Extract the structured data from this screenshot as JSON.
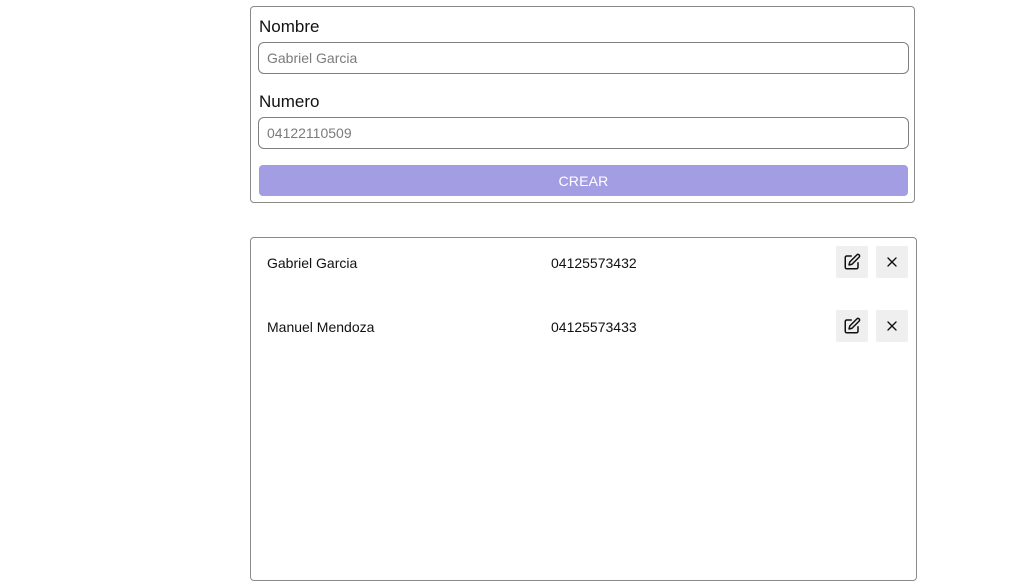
{
  "form": {
    "nombre_label": "Nombre",
    "nombre_placeholder": "Gabriel Garcia",
    "nombre_value": "",
    "numero_label": "Numero",
    "numero_placeholder": "04122110509",
    "numero_value": "",
    "create_label": "CREAR"
  },
  "contacts": [
    {
      "name": "Gabriel Garcia",
      "number": "04125573432",
      "edit_icon": "edit-icon",
      "delete_icon": "close-icon"
    },
    {
      "name": "Manuel Mendoza",
      "number": "04125573433",
      "edit_icon": "edit-icon",
      "delete_icon": "close-icon"
    }
  ],
  "colors": {
    "accent_disabled": "#a39de3",
    "border": "#8a8a8a",
    "icon_button_bg": "#efefef",
    "text": "#111111"
  }
}
